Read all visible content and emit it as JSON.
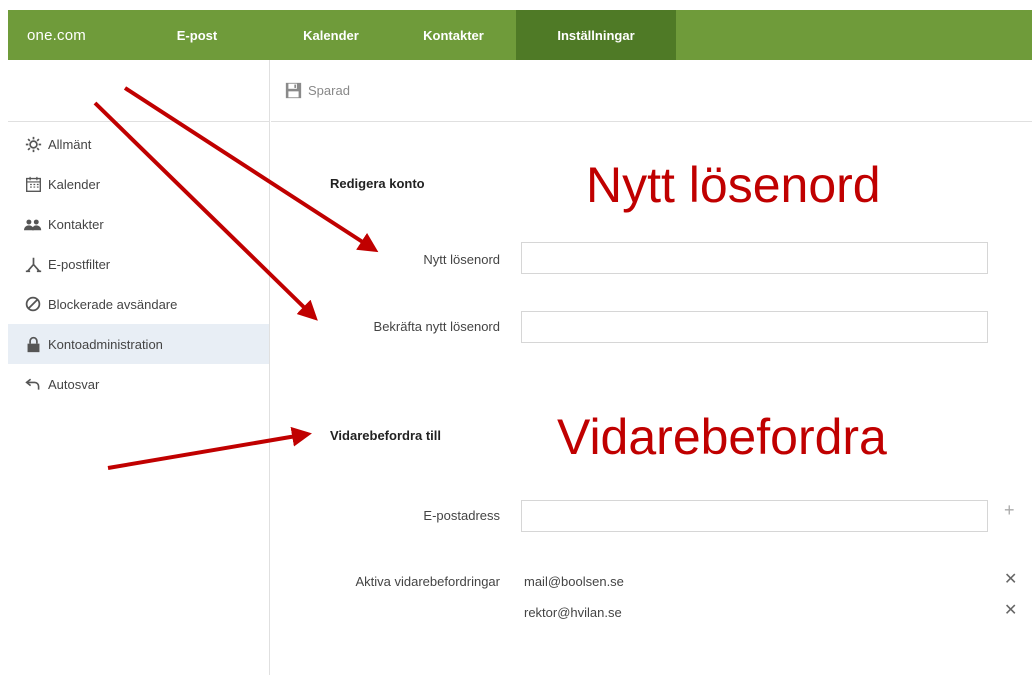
{
  "nav": {
    "logo": "one.com",
    "tabs": [
      "E-post",
      "Kalender",
      "Kontakter",
      "Inställningar"
    ],
    "active_tab": "Inställningar"
  },
  "toolbar": {
    "save_label": "Sparad",
    "save_icon": "save-icon"
  },
  "sidebar": {
    "items": [
      {
        "label": "Allmänt",
        "icon": "gear-icon"
      },
      {
        "label": "Kalender",
        "icon": "calendar-icon"
      },
      {
        "label": "Kontakter",
        "icon": "contacts-icon"
      },
      {
        "label": "E-postfilter",
        "icon": "filter-icon"
      },
      {
        "label": "Blockerade avsändare",
        "icon": "blocked-icon"
      },
      {
        "label": "Kontoadministration",
        "icon": "lock-icon",
        "active": true
      },
      {
        "label": "Autosvar",
        "icon": "reply-icon"
      }
    ]
  },
  "account": {
    "section_title": "Redigera konto",
    "new_password_label": "Nytt lösenord",
    "new_password_value": "",
    "confirm_password_label": "Bekräfta nytt lösenord",
    "confirm_password_value": ""
  },
  "forward": {
    "section_title": "Vidarebefordra till",
    "email_label": "E-postadress",
    "email_value": "",
    "active_label": "Aktiva vidarebefordringar",
    "active_items": [
      "mail@boolsen.se",
      "rektor@hvilan.se"
    ]
  },
  "annotations": {
    "password_note": "Nytt lösenord",
    "forward_note": "Vidarebefordra"
  },
  "colors": {
    "nav_bg": "#6f9b3a",
    "nav_active": "#4f7a26",
    "annotation": "#c00000",
    "sidebar_active": "#e8eef5"
  }
}
